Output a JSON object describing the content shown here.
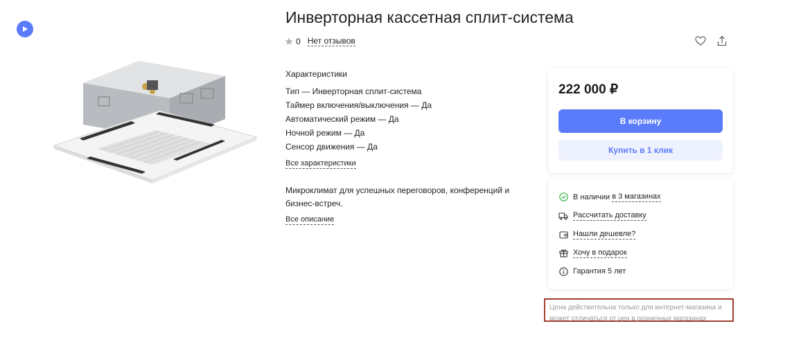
{
  "product": {
    "title": "Инверторная кассетная сплит-система",
    "rating": "0",
    "reviews_link": "Нет отзывов"
  },
  "icons": {
    "play": "play-icon",
    "star": "star-icon",
    "favorite": "heart-icon",
    "share": "share-icon"
  },
  "specs": {
    "heading": "Характеристики",
    "items": [
      "Тип — Инверторная сплит-система",
      "Таймер включения/выключения — Да",
      "Автоматический режим — Да",
      "Ночной режим — Да",
      "Сенсор движения — Да"
    ],
    "all_link": "Все характеристики"
  },
  "description": {
    "text": "Микроклимат для успешных переговоров, конференций и бизнес-встреч.",
    "all_link": "Все описание"
  },
  "buy": {
    "price": "222 000 ₽",
    "cart_label": "В корзину",
    "one_click_label": "Купить в 1 клик"
  },
  "info": {
    "stock_prefix": "В наличии ",
    "stock_link": "в 3 магазинах",
    "delivery": "Рассчитать доставку",
    "cheaper": "Нашли дешевле?",
    "gift": "Хочу в подарок",
    "warranty": "Гарантия 5 лет"
  },
  "notice": "Цена действительна только для интернет-магазина и может отличаться от цен в розничных магазинах",
  "colors": {
    "accent": "#5b7cfa",
    "accent_light": "#eef1fe",
    "in_stock": "#3bb54a",
    "notice_border": "#a23c2e"
  }
}
